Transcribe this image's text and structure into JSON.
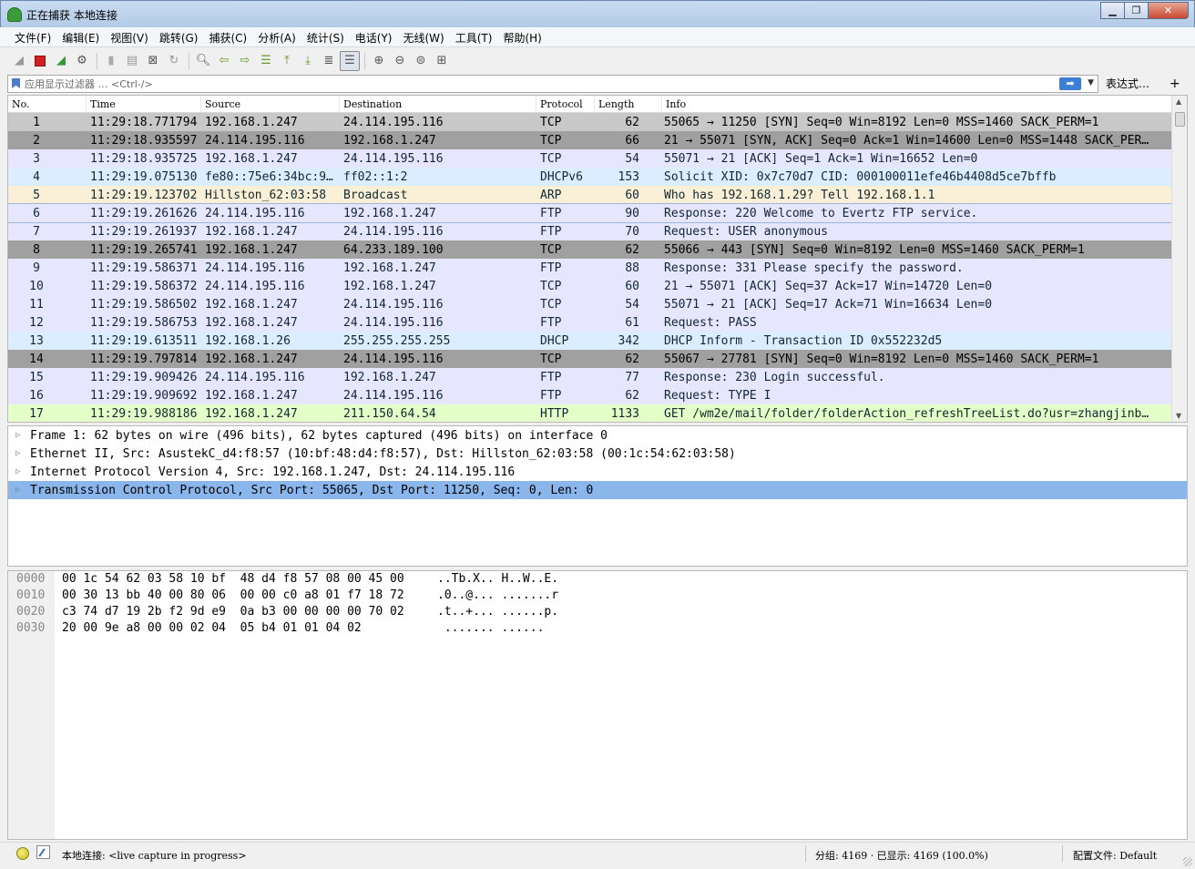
{
  "window": {
    "title": "正在捕获 本地连接"
  },
  "menu": [
    "文件(F)",
    "编辑(E)",
    "视图(V)",
    "跳转(G)",
    "捕获(C)",
    "分析(A)",
    "统计(S)",
    "电话(Y)",
    "无线(W)",
    "工具(T)",
    "帮助(H)"
  ],
  "filter": {
    "placeholder": "应用显示过滤器 … <Ctrl-/>",
    "apply_icon": "➡",
    "dropdown_icon": "▼",
    "expr_label": "表达式…",
    "plus_label": "+"
  },
  "packet_list": {
    "columns": [
      "No.",
      "Time",
      "Source",
      "Destination",
      "Protocol",
      "Length",
      "Info"
    ],
    "rows": [
      {
        "no": "1",
        "time": "11:29:18.771794",
        "src": "192.168.1.247",
        "dst": "24.114.195.116",
        "proto": "TCP",
        "len": "62",
        "info": "55065 → 11250 [SYN] Seq=0 Win=8192 Len=0 MSS=1460 SACK_PERM=1",
        "bg": "#c8c8c8",
        "fg": "#000000"
      },
      {
        "no": "2",
        "time": "11:29:18.935597",
        "src": "24.114.195.116",
        "dst": "192.168.1.247",
        "proto": "TCP",
        "len": "66",
        "info": "21 → 55071 [SYN, ACK] Seq=0 Ack=1 Win=14600 Len=0 MSS=1448 SACK_PER…",
        "bg": "#a0a0a0",
        "fg": "#000000"
      },
      {
        "no": "3",
        "time": "11:29:18.935725",
        "src": "192.168.1.247",
        "dst": "24.114.195.116",
        "proto": "TCP",
        "len": "54",
        "info": "55071 → 21 [ACK] Seq=1 Ack=1 Win=16652 Len=0",
        "bg": "#e7e6ff",
        "fg": "#12272e"
      },
      {
        "no": "4",
        "time": "11:29:19.075130",
        "src": "fe80::75e6:34bc:9…",
        "dst": "ff02::1:2",
        "proto": "DHCPv6",
        "len": "153",
        "info": "Solicit XID: 0x7c70d7 CID: 000100011efe46b4408d5ce7bffb",
        "bg": "#daeeff",
        "fg": "#12272e"
      },
      {
        "no": "5",
        "time": "11:29:19.123702",
        "src": "Hillston_62:03:58",
        "dst": "Broadcast",
        "proto": "ARP",
        "len": "60",
        "info": "Who has 192.168.1.29? Tell 192.168.1.1",
        "bg": "#faf0d7",
        "fg": "#12272e"
      },
      {
        "no": "6",
        "time": "11:29:19.261626",
        "src": "24.114.195.116",
        "dst": "192.168.1.247",
        "proto": "FTP",
        "len": "90",
        "info": "Response: 220 Welcome to Evertz FTP service.",
        "bg": "#e7e6ff",
        "fg": "#12272e"
      },
      {
        "no": "7",
        "time": "11:29:19.261937",
        "src": "192.168.1.247",
        "dst": "24.114.195.116",
        "proto": "FTP",
        "len": "70",
        "info": "Request: USER anonymous",
        "bg": "#e7e6ff",
        "fg": "#12272e"
      },
      {
        "no": "8",
        "time": "11:29:19.265741",
        "src": "192.168.1.247",
        "dst": "64.233.189.100",
        "proto": "TCP",
        "len": "62",
        "info": "55066 → 443 [SYN] Seq=0 Win=8192 Len=0 MSS=1460 SACK_PERM=1",
        "bg": "#a0a0a0",
        "fg": "#000000"
      },
      {
        "no": "9",
        "time": "11:29:19.586371",
        "src": "24.114.195.116",
        "dst": "192.168.1.247",
        "proto": "FTP",
        "len": "88",
        "info": "Response: 331 Please specify the password.",
        "bg": "#e7e6ff",
        "fg": "#12272e"
      },
      {
        "no": "10",
        "time": "11:29:19.586372",
        "src": "24.114.195.116",
        "dst": "192.168.1.247",
        "proto": "TCP",
        "len": "60",
        "info": "21 → 55071 [ACK] Seq=37 Ack=17 Win=14720 Len=0",
        "bg": "#e7e6ff",
        "fg": "#12272e"
      },
      {
        "no": "11",
        "time": "11:29:19.586502",
        "src": "192.168.1.247",
        "dst": "24.114.195.116",
        "proto": "TCP",
        "len": "54",
        "info": "55071 → 21 [ACK] Seq=17 Ack=71 Win=16634 Len=0",
        "bg": "#e7e6ff",
        "fg": "#12272e"
      },
      {
        "no": "12",
        "time": "11:29:19.586753",
        "src": "192.168.1.247",
        "dst": "24.114.195.116",
        "proto": "FTP",
        "len": "61",
        "info": "Request: PASS",
        "bg": "#e7e6ff",
        "fg": "#12272e"
      },
      {
        "no": "13",
        "time": "11:29:19.613511",
        "src": "192.168.1.26",
        "dst": "255.255.255.255",
        "proto": "DHCP",
        "len": "342",
        "info": "DHCP Inform   - Transaction ID 0x552232d5",
        "bg": "#daeeff",
        "fg": "#12272e"
      },
      {
        "no": "14",
        "time": "11:29:19.797814",
        "src": "192.168.1.247",
        "dst": "24.114.195.116",
        "proto": "TCP",
        "len": "62",
        "info": "55067 → 27781 [SYN] Seq=0 Win=8192 Len=0 MSS=1460 SACK_PERM=1",
        "bg": "#a0a0a0",
        "fg": "#000000"
      },
      {
        "no": "15",
        "time": "11:29:19.909426",
        "src": "24.114.195.116",
        "dst": "192.168.1.247",
        "proto": "FTP",
        "len": "77",
        "info": "Response: 230 Login successful.",
        "bg": "#e7e6ff",
        "fg": "#12272e"
      },
      {
        "no": "16",
        "time": "11:29:19.909692",
        "src": "192.168.1.247",
        "dst": "24.114.195.116",
        "proto": "FTP",
        "len": "62",
        "info": "Request: TYPE I",
        "bg": "#e7e6ff",
        "fg": "#12272e"
      },
      {
        "no": "17",
        "time": "11:29:19.988186",
        "src": "192.168.1.247",
        "dst": "211.150.64.54",
        "proto": "HTTP",
        "len": "1133",
        "info": "GET /wm2e/mail/folder/folderAction_refreshTreeList.do?usr=zhangjinb…",
        "bg": "#e4ffc7",
        "fg": "#12272e"
      }
    ]
  },
  "details": [
    {
      "text": "Frame 1: 62 bytes on wire (496 bits), 62 bytes captured (496 bits) on interface 0",
      "selected": false
    },
    {
      "text": "Ethernet II, Src: AsustekC_d4:f8:57 (10:bf:48:d4:f8:57), Dst: Hillston_62:03:58 (00:1c:54:62:03:58)",
      "selected": false
    },
    {
      "text": "Internet Protocol Version 4, Src: 192.168.1.247, Dst: 24.114.195.116",
      "selected": false
    },
    {
      "text": "Transmission Control Protocol, Src Port: 55065, Dst Port: 11250, Seq: 0, Len: 0",
      "selected": true
    }
  ],
  "hex": [
    {
      "offset": "0000",
      "bytes": "00 1c 54 62 03 58 10 bf  48 d4 f8 57 08 00 45 00",
      "ascii": "..Tb.X.. H..W..E."
    },
    {
      "offset": "0010",
      "bytes": "00 30 13 bb 40 00 80 06  00 00 c0 a8 01 f7 18 72",
      "ascii": ".0..@... .......r"
    },
    {
      "offset": "0020",
      "bytes": "c3 74 d7 19 2b f2 9d e9  0a b3 00 00 00 00 70 02",
      "ascii": ".t..+... ......p."
    },
    {
      "offset": "0030",
      "bytes": "20 00 9e a8 00 00 02 04  05 b4 01 01 04 02",
      "ascii": " ....... ......"
    }
  ],
  "status": {
    "capture": "本地连接: <live capture in progress>",
    "packets": "分组: 4169 · 已显示: 4169 (100.0%)",
    "profile": "配置文件: Default"
  },
  "colors": {
    "selected_detail": "#8ab6ec",
    "filter_apply": "#3b7fd6"
  },
  "icons": [
    "shark-fin-start-icon",
    "stop-icon",
    "restart-icon",
    "options-gear-icon",
    "open-file-icon",
    "save-icon",
    "close-file-icon",
    "reload-icon",
    "find-icon",
    "go-back-icon",
    "go-forward-icon",
    "go-to-packet-icon",
    "first-packet-icon",
    "last-packet-icon",
    "autoscroll-icon",
    "colorize-icon",
    "zoom-in-icon",
    "zoom-out-icon",
    "normal-size-icon",
    "resize-columns-icon"
  ]
}
